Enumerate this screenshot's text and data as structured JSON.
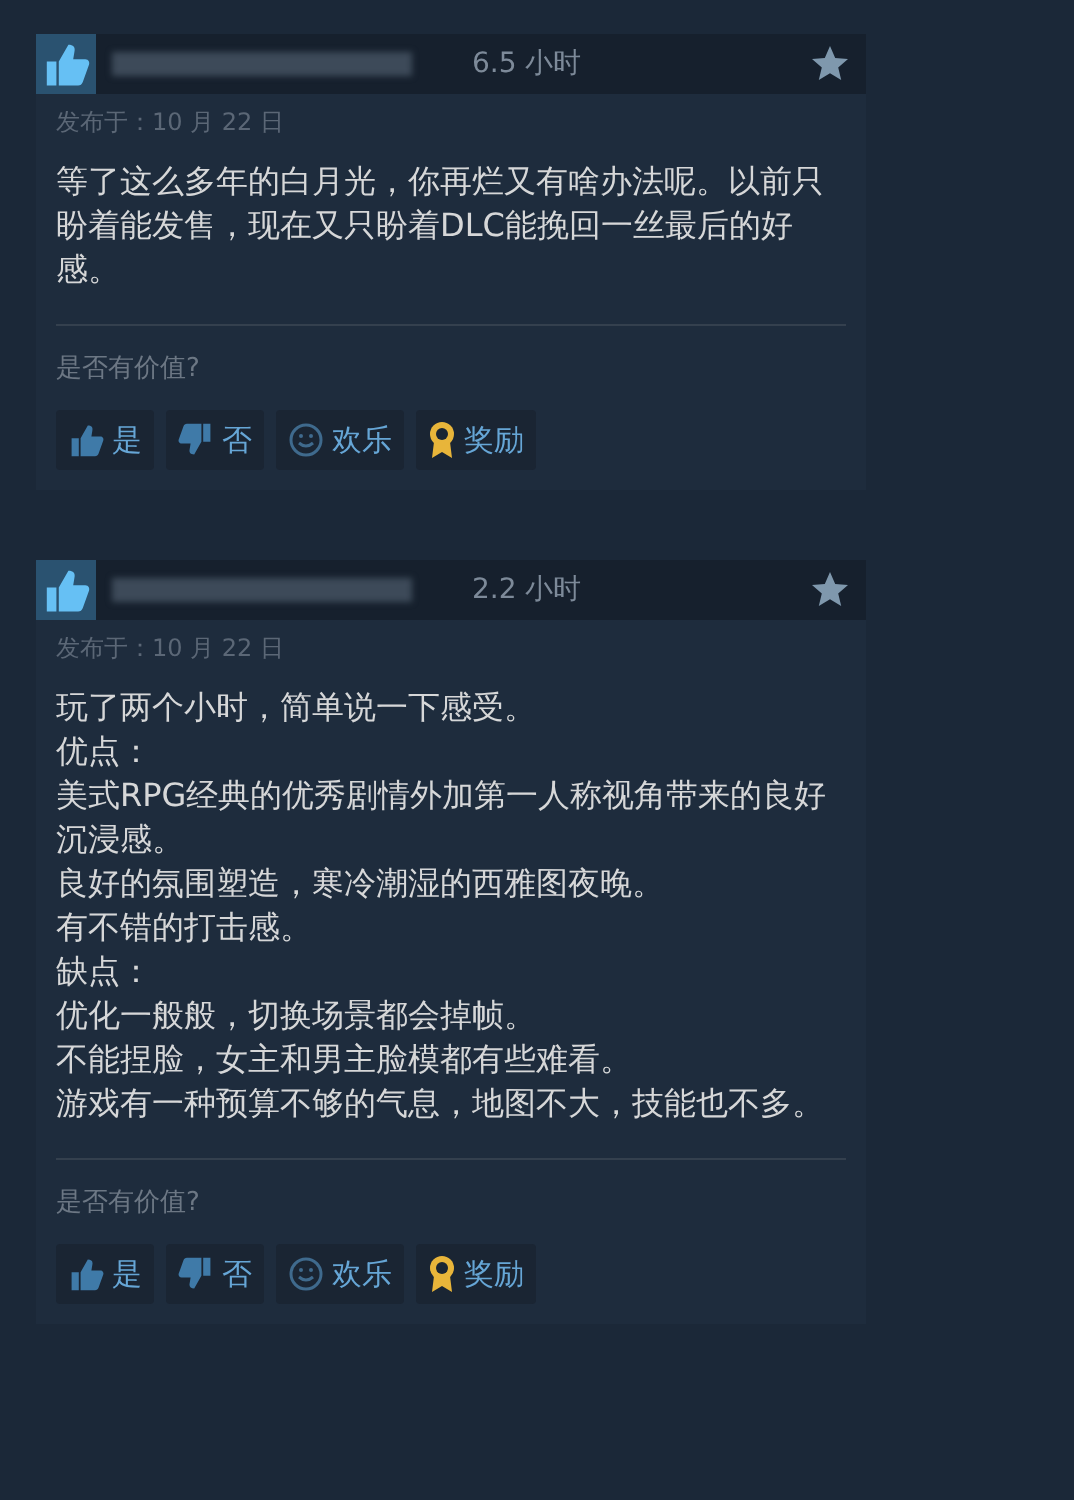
{
  "reviews": [
    {
      "recommended": true,
      "hours": "6.5 小时",
      "posted": "发布于：10 月 22 日",
      "paragraphs": [
        "等了这么多年的白月光，你再烂又有啥办法呢。以前只盼着能发售，现在又只盼着DLC能挽回一丝最后的好感。"
      ],
      "helpful_prompt": "是否有价值?",
      "buttons": [
        {
          "kind": "yes",
          "label": "是"
        },
        {
          "kind": "no",
          "label": "否"
        },
        {
          "kind": "funny",
          "label": "欢乐"
        },
        {
          "kind": "award",
          "label": "奖励"
        }
      ]
    },
    {
      "recommended": true,
      "hours": "2.2 小时",
      "posted": "发布于：10 月 22 日",
      "paragraphs": [
        "玩了两个小时，简单说一下感受。",
        "优点：",
        "美式RPG经典的优秀剧情外加第一人称视角带来的良好沉浸感。",
        "良好的氛围塑造，寒冷潮湿的西雅图夜晚。",
        "有不错的打击感。",
        "缺点：",
        "优化一般般，切换场景都会掉帧。",
        "不能捏脸，女主和男主脸模都有些难看。",
        "游戏有一种预算不够的气息，地图不大，技能也不多。"
      ],
      "helpful_prompt": "是否有价值?",
      "buttons": [
        {
          "kind": "yes",
          "label": "是"
        },
        {
          "kind": "no",
          "label": "否"
        },
        {
          "kind": "funny",
          "label": "欢乐"
        },
        {
          "kind": "award",
          "label": "奖励"
        }
      ]
    }
  ]
}
